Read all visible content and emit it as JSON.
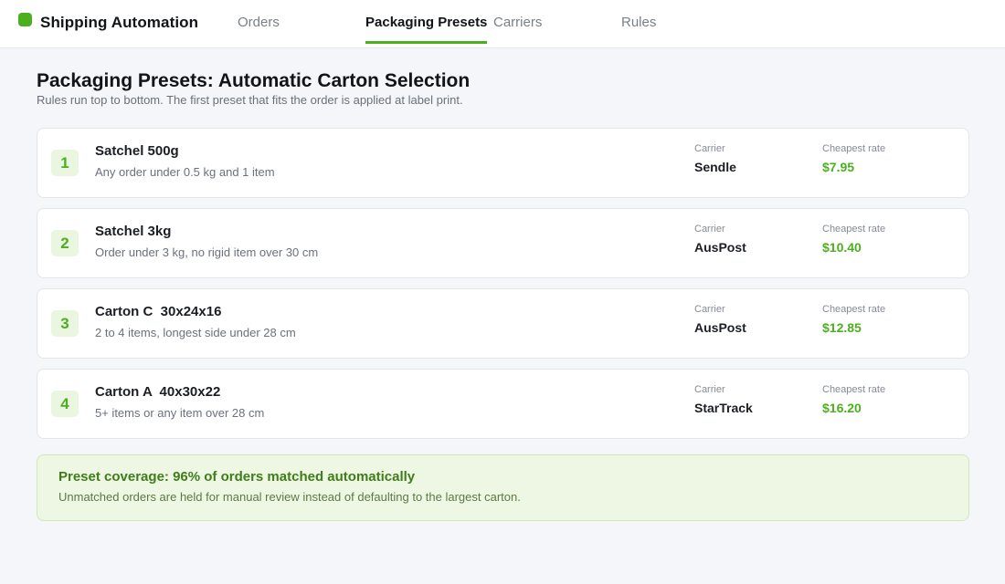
{
  "app": {
    "brand": "Shipping Automation"
  },
  "nav": {
    "tabs": [
      {
        "label": "Orders"
      },
      {
        "label": "Packaging Presets",
        "active": true
      },
      {
        "label": "Carriers"
      },
      {
        "label": "Rules"
      }
    ]
  },
  "page": {
    "title": "Packaging Presets: Automatic Carton Selection",
    "subtitle": "Rules run top to bottom. The first preset that fits the order is applied at label print."
  },
  "labels": {
    "carrier": "Carrier",
    "rate": "Cheapest rate"
  },
  "presets": [
    {
      "rank": "1",
      "name": "Satchel 500g",
      "rule": "Any order under 0.5 kg and 1 item",
      "carrier": "Sendle",
      "rate": "$7.95"
    },
    {
      "rank": "2",
      "name": "Satchel 3kg",
      "rule": "Order under 3 kg, no rigid item over 30 cm",
      "carrier": "AusPost",
      "rate": "$10.40"
    },
    {
      "rank": "3",
      "name": "Carton C  30x24x16",
      "rule": "2 to 4 items, longest side under 28 cm",
      "carrier": "AusPost",
      "rate": "$12.85"
    },
    {
      "rank": "4",
      "name": "Carton A  40x30x22",
      "rule": "5+ items or any item over 28 cm",
      "carrier": "StarTrack",
      "rate": "$16.20"
    }
  ],
  "coverage": {
    "title": "Preset coverage: 96% of orders matched automatically",
    "note": "Unmatched orders are held for manual review instead of defaulting to the largest carton."
  },
  "colors": {
    "accent": "#4caf1f",
    "background": "#f4f6f9",
    "coverage_bg": "#eef7e3"
  }
}
